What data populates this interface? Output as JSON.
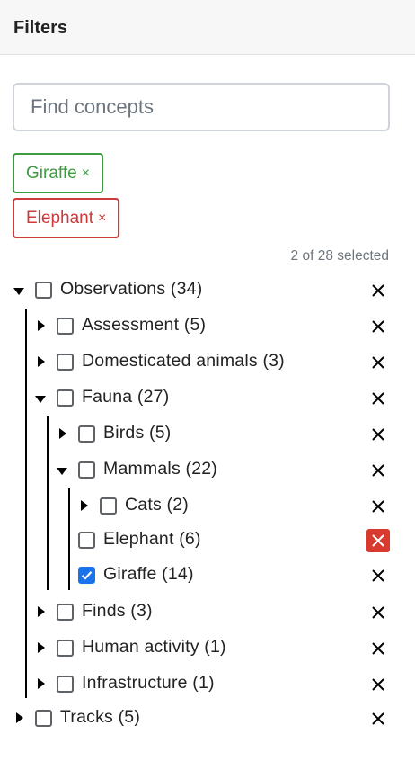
{
  "header": {
    "title": "Filters"
  },
  "search": {
    "placeholder": "Find concepts"
  },
  "selected_tags": [
    {
      "label": "Giraffe",
      "remove": "×",
      "color": "#3d9b42"
    },
    {
      "label": "Elephant",
      "remove": "×",
      "color": "#cc3a3a"
    }
  ],
  "selected_count": "2 of 28 selected",
  "icons": {
    "expand": "caret-right-icon",
    "collapse": "caret-down-icon",
    "remove": "close-icon",
    "check": "checkmark-icon"
  },
  "colors": {
    "checkbox_checked": "#1a73e8",
    "remove_active_bg": "#d93a2f"
  },
  "tree": [
    {
      "label": "Observations (34)",
      "state": "expanded",
      "checked": false
    },
    {
      "label": "Assessment (5)",
      "state": "collapsed",
      "checked": false
    },
    {
      "label": "Domesticated animals (3)",
      "state": "collapsed",
      "checked": false
    },
    {
      "label": "Fauna (27)",
      "state": "expanded",
      "checked": false
    },
    {
      "label": "Birds (5)",
      "state": "collapsed",
      "checked": false
    },
    {
      "label": "Mammals (22)",
      "state": "expanded",
      "checked": false
    },
    {
      "label": "Cats (2)",
      "state": "collapsed",
      "checked": false
    },
    {
      "label": "Elephant (6)",
      "state": "leaf",
      "checked": false,
      "remove_highlighted": true
    },
    {
      "label": "Giraffe (14)",
      "state": "leaf",
      "checked": true
    },
    {
      "label": "Finds (3)",
      "state": "collapsed",
      "checked": false
    },
    {
      "label": "Human activity (1)",
      "state": "collapsed",
      "checked": false
    },
    {
      "label": "Infrastructure (1)",
      "state": "collapsed",
      "checked": false
    },
    {
      "label": "Tracks (5)",
      "state": "collapsed",
      "checked": false
    }
  ]
}
